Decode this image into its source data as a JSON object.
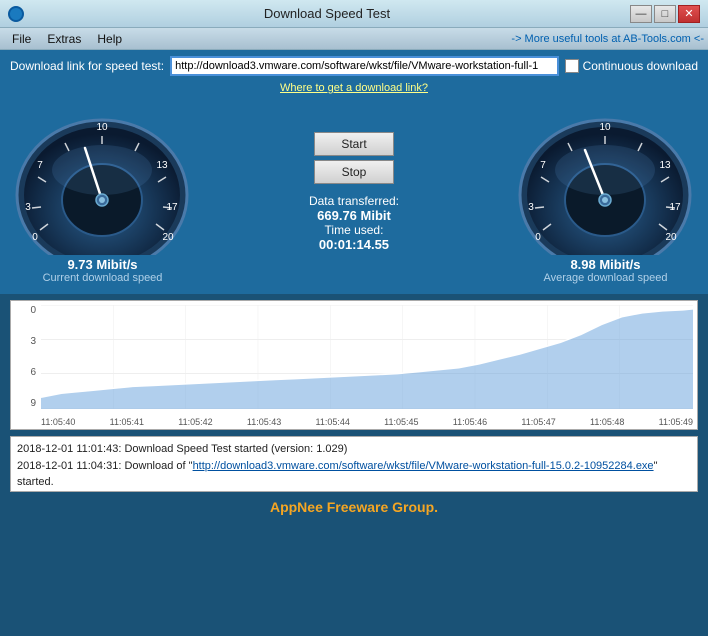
{
  "window": {
    "title": "Download Speed Test",
    "icon": "⬇",
    "controls": {
      "minimize": "—",
      "maximize": "□",
      "close": "✕"
    }
  },
  "menu": {
    "items": [
      "File",
      "Extras",
      "Help"
    ],
    "right_link": "-> More useful tools at AB-Tools.com <-"
  },
  "url_row": {
    "label": "Download link for speed test:",
    "url_value": "http://download3.vmware.com/software/wkst/file/VMware-workstation-full-1",
    "continuous_label": "Continuous download"
  },
  "where_link": "Where to get a download link?",
  "buttons": {
    "start": "Start",
    "stop": "Stop"
  },
  "gauge_left": {
    "value": "9.73 Mibit/s",
    "label": "Current download speed",
    "needle_angle": -20,
    "max_val": 20
  },
  "gauge_right": {
    "value": "8.98 Mibit/s",
    "label": "Average download speed",
    "needle_angle": -25,
    "max_val": 20
  },
  "data_info": {
    "transferred_label": "Data transferred:",
    "transferred_value": "669.76 Mibit",
    "time_label": "Time used:",
    "time_value": "00:01:14.55"
  },
  "chart": {
    "y_labels": [
      "0",
      "3",
      "6",
      "9"
    ],
    "x_labels": [
      "11:05:40",
      "11:05:41",
      "11:05:42",
      "11:05:43",
      "11:05:44",
      "11:05:45",
      "11:05:46",
      "11:05:47",
      "11:05:48",
      "11:05:49"
    ]
  },
  "log": {
    "lines": [
      "2018-12-01 11:01:43: Download Speed Test started (version: 1.029)",
      "2018-12-01 11:04:31: Download of \"http://download3.vmware.com/software/wkst/file/VMware-workstation-full-15.0.2-10952284.exe\" started."
    ]
  },
  "footer": {
    "text": "AppNee Freeware Group."
  }
}
